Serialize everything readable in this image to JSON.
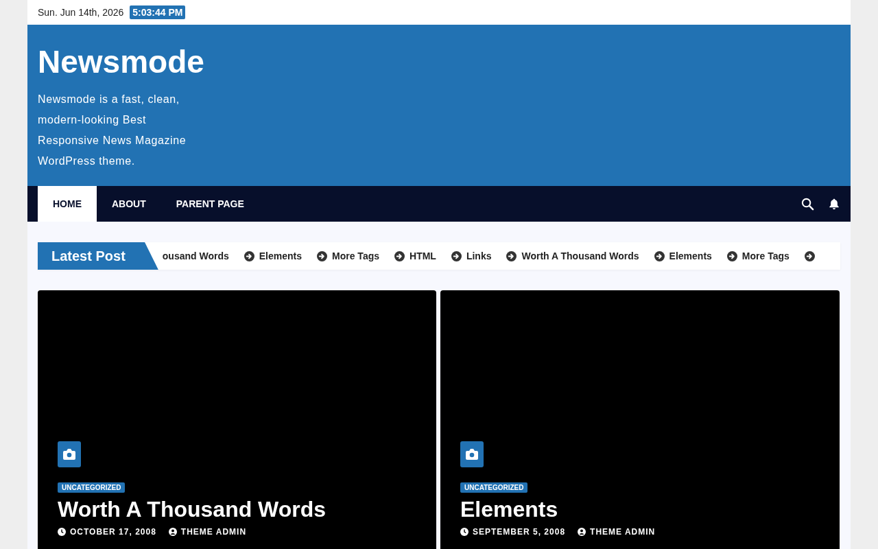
{
  "top_bar": {
    "date": "Sun. Jun 14th, 2026",
    "time": "5:03:44 PM"
  },
  "header": {
    "site_title": "Newsmode",
    "tagline": "Newsmode is a fast, clean, modern-looking Best Responsive News Magazine WordPress theme."
  },
  "nav": {
    "items": [
      {
        "label": "HOME",
        "selected": true
      },
      {
        "label": "ABOUT",
        "selected": false
      },
      {
        "label": "PARENT PAGE",
        "selected": false
      }
    ]
  },
  "ticker": {
    "label": "Latest Post",
    "items": [
      {
        "title": "ousand Words",
        "partial": true
      },
      {
        "title": "Elements",
        "partial": false
      },
      {
        "title": "More Tags",
        "partial": false
      },
      {
        "title": "HTML",
        "partial": false
      },
      {
        "title": "Links",
        "partial": false
      },
      {
        "title": "Worth A Thousand Words",
        "partial": false
      },
      {
        "title": "Elements",
        "partial": false
      },
      {
        "title": "More Tags",
        "partial": false
      }
    ]
  },
  "posts": [
    {
      "category": "UNCATEGORIZED",
      "title": "Worth A Thousand Words",
      "date": "OCTOBER 17, 2008",
      "author": "THEME ADMIN"
    },
    {
      "category": "UNCATEGORIZED",
      "title": "Elements",
      "date": "SEPTEMBER 5, 2008",
      "author": "THEME ADMIN"
    }
  ]
}
